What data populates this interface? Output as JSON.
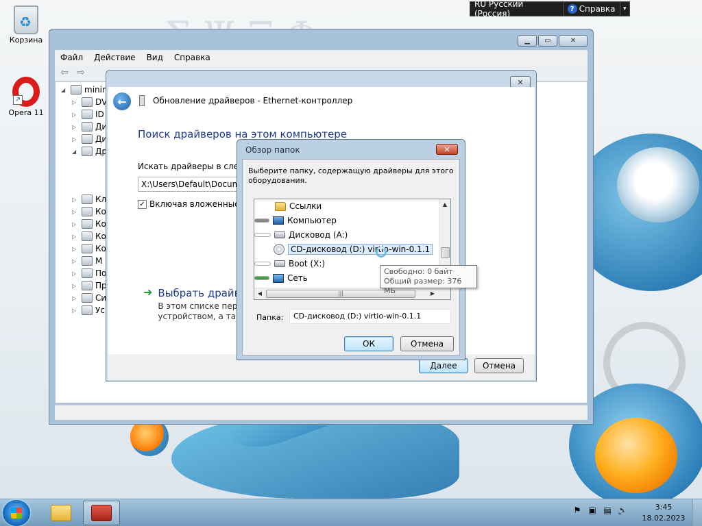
{
  "language_bar": {
    "language": "RU Русский (Россия)",
    "help": "Справка"
  },
  "desktop": {
    "icons": [
      {
        "label": "Корзина"
      },
      {
        "label": "Opera 11"
      }
    ]
  },
  "device_manager": {
    "menu": [
      "Файл",
      "Действие",
      "Вид",
      "Справка"
    ],
    "tree": [
      {
        "text": "minin"
      },
      {
        "text": "DV"
      },
      {
        "text": "ID"
      },
      {
        "text": "Ди"
      },
      {
        "text": "Ди"
      },
      {
        "text": "Др"
      },
      {
        "text": "Кл"
      },
      {
        "text": "Ко"
      },
      {
        "text": "Ко"
      },
      {
        "text": "Ко"
      },
      {
        "text": "Ко"
      },
      {
        "text": "М"
      },
      {
        "text": "По"
      },
      {
        "text": "Пр"
      },
      {
        "text": "Си"
      },
      {
        "text": "Ус"
      }
    ]
  },
  "update_dialog": {
    "title": "Обновление драйверов - Ethernet-контроллер",
    "heading": "Поиск драйверов на этом компьютере",
    "search_label": "Искать драйверы в следую",
    "path_value": "X:\\Users\\Default\\Documen",
    "include_subfolders": "Включая вложенные па",
    "include_subfolders_checked": true,
    "choose_title": "Выбрать драйвер",
    "choose_desc_line1": "В этом списке переч",
    "choose_desc_line2": "устройством, а такж",
    "next_label": "Далее",
    "cancel_label": "Отмена"
  },
  "browse_dialog": {
    "title": "Обзор папок",
    "instruction": "Выберите папку, содержащую драйверы для этого оборудования.",
    "tree": [
      {
        "label": "Ссылки",
        "icon": "folder-icon"
      },
      {
        "label": "Компьютер",
        "icon": "computer-icon"
      },
      {
        "label": "Дисковод (A:)",
        "icon": "floppy-drive-icon"
      },
      {
        "label": "CD-дисковод (D:) virtio-win-0.1.1",
        "icon": "cd-drive-icon",
        "selected": true
      },
      {
        "label": "Boot (X:)",
        "icon": "drive-icon"
      },
      {
        "label": "Сеть",
        "icon": "network-icon"
      }
    ],
    "folder_label": "Папка:",
    "folder_value": "CD-дисковод (D:) virtio-win-0.1.1",
    "ok_label": "ОК",
    "cancel_label": "Отмена"
  },
  "tooltip": {
    "free": "Свободно: 0 байт",
    "total": "Общий размер: 376 МБ"
  },
  "taskbar": {
    "time": "3:45",
    "date": "18.02.2023"
  }
}
